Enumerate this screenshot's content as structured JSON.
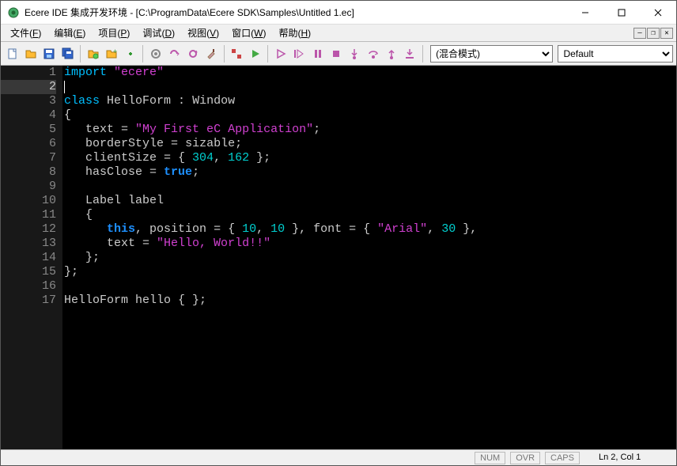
{
  "window": {
    "title": "Ecere IDE 集成开发环境 - [C:\\ProgramData\\Ecere SDK\\Samples\\Untitled 1.ec]"
  },
  "menu": {
    "file": {
      "label": "文件",
      "accel": "F"
    },
    "edit": {
      "label": "编辑",
      "accel": "E"
    },
    "project": {
      "label": "项目",
      "accel": "P"
    },
    "debug": {
      "label": "调试",
      "accel": "D"
    },
    "view": {
      "label": "视图",
      "accel": "V"
    },
    "window": {
      "label": "窗口",
      "accel": "W"
    },
    "help": {
      "label": "帮助",
      "accel": "H"
    }
  },
  "toolbar": {
    "mode_label": "(混合模式)",
    "config_label": "Default",
    "icons": {
      "new": "new-file",
      "open": "open-file",
      "save": "save",
      "saveall": "save-all",
      "openproj": "open-project",
      "addproj": "add-project",
      "addfile": "add-file",
      "build": "build",
      "rebuild": "rebuild",
      "clean": "clean",
      "cleanall": "clean-all",
      "toggle": "toggle-breakpoint",
      "run": "run",
      "sep": "separator",
      "start": "debug-start",
      "restart": "debug-restart",
      "pause": "debug-pause",
      "stop": "debug-stop",
      "stepinto": "step-into",
      "stepover": "step-over",
      "stepout": "step-out",
      "runto": "run-to-cursor"
    }
  },
  "editor": {
    "current_line": 2,
    "lines": [
      {
        "n": 1,
        "tokens": [
          [
            "kw2",
            "import"
          ],
          [
            "punc",
            " "
          ],
          [
            "str",
            "\"ecere\""
          ]
        ]
      },
      {
        "n": 2,
        "tokens": [
          [
            "cursor",
            ""
          ]
        ]
      },
      {
        "n": 3,
        "tokens": [
          [
            "kw2",
            "class"
          ],
          [
            "punc",
            " "
          ],
          [
            "id",
            "HelloForm"
          ],
          [
            "punc",
            " : "
          ],
          [
            "id",
            "Window"
          ]
        ]
      },
      {
        "n": 4,
        "tokens": [
          [
            "punc",
            "{"
          ]
        ]
      },
      {
        "n": 5,
        "tokens": [
          [
            "punc",
            "   "
          ],
          [
            "id",
            "text"
          ],
          [
            "punc",
            " = "
          ],
          [
            "str",
            "\"My First eC Application\""
          ],
          [
            "punc",
            ";"
          ]
        ]
      },
      {
        "n": 6,
        "tokens": [
          [
            "punc",
            "   "
          ],
          [
            "id",
            "borderStyle"
          ],
          [
            "punc",
            " = "
          ],
          [
            "id",
            "sizable"
          ],
          [
            "punc",
            ";"
          ]
        ]
      },
      {
        "n": 7,
        "tokens": [
          [
            "punc",
            "   "
          ],
          [
            "id",
            "clientSize"
          ],
          [
            "punc",
            " = { "
          ],
          [
            "num",
            "304"
          ],
          [
            "punc",
            ", "
          ],
          [
            "num",
            "162"
          ],
          [
            "punc",
            " };"
          ]
        ]
      },
      {
        "n": 8,
        "tokens": [
          [
            "punc",
            "   "
          ],
          [
            "id",
            "hasClose"
          ],
          [
            "punc",
            " = "
          ],
          [
            "kw",
            "true"
          ],
          [
            "punc",
            ";"
          ]
        ]
      },
      {
        "n": 9,
        "tokens": []
      },
      {
        "n": 10,
        "tokens": [
          [
            "punc",
            "   "
          ],
          [
            "id",
            "Label"
          ],
          [
            "punc",
            " "
          ],
          [
            "id",
            "label"
          ]
        ]
      },
      {
        "n": 11,
        "tokens": [
          [
            "punc",
            "   {"
          ]
        ]
      },
      {
        "n": 12,
        "tokens": [
          [
            "punc",
            "      "
          ],
          [
            "kw",
            "this"
          ],
          [
            "punc",
            ", "
          ],
          [
            "id",
            "position"
          ],
          [
            "punc",
            " = { "
          ],
          [
            "num",
            "10"
          ],
          [
            "punc",
            ", "
          ],
          [
            "num",
            "10"
          ],
          [
            "punc",
            " }, "
          ],
          [
            "id",
            "font"
          ],
          [
            "punc",
            " = { "
          ],
          [
            "str",
            "\"Arial\""
          ],
          [
            "punc",
            ", "
          ],
          [
            "num",
            "30"
          ],
          [
            "punc",
            " },"
          ]
        ]
      },
      {
        "n": 13,
        "tokens": [
          [
            "punc",
            "      "
          ],
          [
            "id",
            "text"
          ],
          [
            "punc",
            " = "
          ],
          [
            "str",
            "\"Hello, World!!\""
          ]
        ]
      },
      {
        "n": 14,
        "tokens": [
          [
            "punc",
            "   };"
          ]
        ]
      },
      {
        "n": 15,
        "tokens": [
          [
            "punc",
            "};"
          ]
        ]
      },
      {
        "n": 16,
        "tokens": []
      },
      {
        "n": 17,
        "tokens": [
          [
            "id",
            "HelloForm"
          ],
          [
            "punc",
            " "
          ],
          [
            "id",
            "hello"
          ],
          [
            "punc",
            " { };"
          ]
        ]
      }
    ]
  },
  "status": {
    "num": "NUM",
    "ovr": "OVR",
    "caps": "CAPS",
    "pos": "Ln 2, Col 1"
  }
}
